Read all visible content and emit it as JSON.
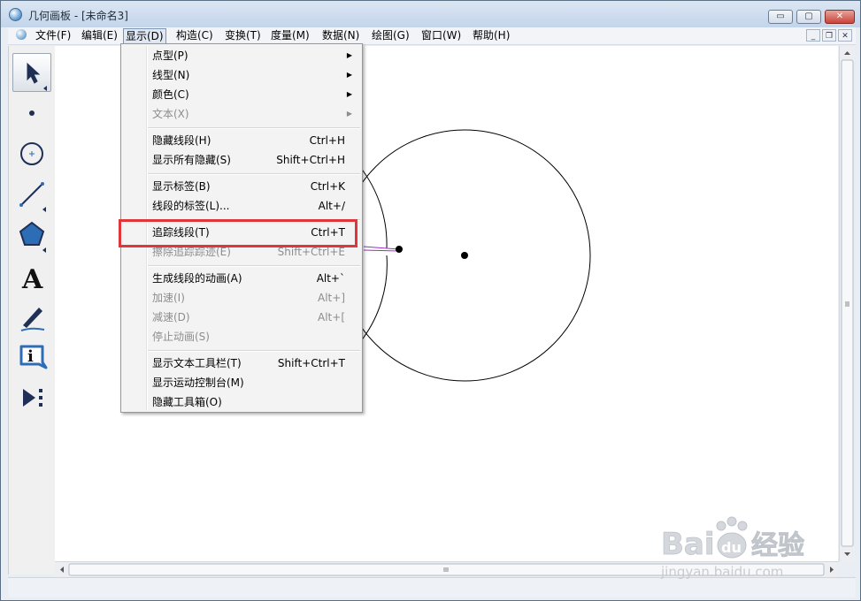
{
  "window": {
    "title": "几何画板 - [未命名3]",
    "controls": {
      "minimize": "▭",
      "maximize": "▢",
      "close": "✕"
    }
  },
  "menubar": {
    "items": [
      {
        "label": "文件(F)"
      },
      {
        "label": "编辑(E)"
      },
      {
        "label": "显示(D)"
      },
      {
        "label": "构造(C)"
      },
      {
        "label": "变换(T)"
      },
      {
        "label": "度量(M)"
      },
      {
        "label": "数据(N)"
      },
      {
        "label": "绘图(G)"
      },
      {
        "label": "窗口(W)"
      },
      {
        "label": "帮助(H)"
      }
    ],
    "mdi": {
      "minimize": "_",
      "restore": "❐",
      "close": "✕"
    }
  },
  "toolbox": {
    "tools": [
      {
        "name": "arrow-select-tool",
        "selected": true
      },
      {
        "name": "point-tool"
      },
      {
        "name": "compass-tool"
      },
      {
        "name": "straightedge-tool"
      },
      {
        "name": "polygon-tool"
      },
      {
        "name": "text-tool",
        "glyph": "A"
      },
      {
        "name": "marker-tool"
      },
      {
        "name": "information-tool",
        "glyph": "i"
      },
      {
        "name": "custom-tool"
      }
    ]
  },
  "display_menu": {
    "items": [
      {
        "label": "点型(P)",
        "submenu": true
      },
      {
        "label": "线型(N)",
        "submenu": true
      },
      {
        "label": "颜色(C)",
        "submenu": true
      },
      {
        "label": "文本(X)",
        "submenu": true,
        "disabled": true
      },
      {
        "label": "隐藏线段(H)",
        "shortcut": "Ctrl+H"
      },
      {
        "label": "显示所有隐藏(S)",
        "shortcut": "Shift+Ctrl+H"
      },
      {
        "label": "显示标签(B)",
        "shortcut": "Ctrl+K"
      },
      {
        "label": "线段的标签(L)...",
        "shortcut": "Alt+/"
      },
      {
        "label": "追踪线段(T)",
        "shortcut": "Ctrl+T",
        "highlighted": true
      },
      {
        "label": "擦除追踪踪迹(E)",
        "shortcut": "Shift+Ctrl+E",
        "disabled": true
      },
      {
        "label": "生成线段的动画(A)",
        "shortcut": "Alt+`"
      },
      {
        "label": "加速(I)",
        "shortcut": "Alt+]",
        "disabled": true
      },
      {
        "label": "减速(D)",
        "shortcut": "Alt+[",
        "disabled": true
      },
      {
        "label": "停止动画(S)",
        "disabled": true
      },
      {
        "label": "显示文本工具栏(T)",
        "shortcut": "Shift+Ctrl+T"
      },
      {
        "label": "显示运动控制台(M)"
      },
      {
        "label": "隐藏工具箱(O)"
      }
    ]
  },
  "colors": {
    "highlight_box": "#e0363a",
    "segment": "#9b2fc4",
    "circle_stroke": "#000000"
  },
  "watermark": {
    "brand": "Bai",
    "paw": "du",
    "cn": "经验",
    "url": "jingyan.baidu.com"
  }
}
